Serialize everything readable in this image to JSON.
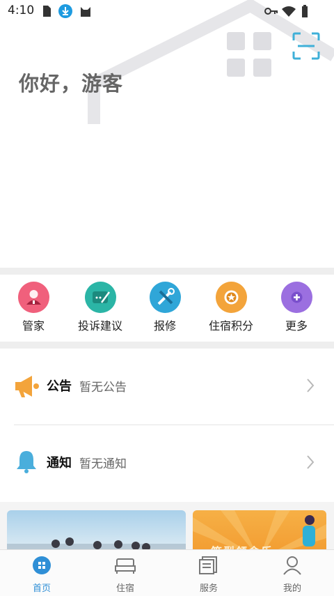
{
  "status_bar": {
    "time": "4:10",
    "icons": [
      "sim-card-icon",
      "download-icon",
      "cat-app-icon",
      "key-icon",
      "wifi-icon",
      "battery-icon"
    ]
  },
  "header": {
    "greeting": "你好，游客",
    "grid_icon": "apps-grid-icon",
    "scan_icon": "scan-icon"
  },
  "quick_actions": [
    {
      "label": "管家",
      "icon": "butler-icon",
      "color": "#f0607c"
    },
    {
      "label": "投诉建议",
      "icon": "feedback-icon",
      "color": "#2bb5a6"
    },
    {
      "label": "报修",
      "icon": "repair-icon",
      "color": "#2fa6d8"
    },
    {
      "label": "住宿积分",
      "icon": "points-icon",
      "color": "#f3a43b"
    },
    {
      "label": "更多",
      "icon": "more-icon",
      "color": "#9b6fe0"
    }
  ],
  "notices": [
    {
      "title": "公告",
      "text": "暂无公告",
      "icon": "megaphone-icon"
    },
    {
      "title": "通知",
      "text": "暂无通知",
      "icon": "bell-icon"
    }
  ],
  "banners": [
    {
      "text": ""
    },
    {
      "text": "笑型领舍乐"
    }
  ],
  "tabs": [
    {
      "label": "首页",
      "icon": "home-icon",
      "active": true
    },
    {
      "label": "住宿",
      "icon": "bed-icon",
      "active": false
    },
    {
      "label": "服务",
      "icon": "service-icon",
      "active": false
    },
    {
      "label": "我的",
      "icon": "user-icon",
      "active": false
    }
  ],
  "colors": {
    "accent": "#2f8fd6",
    "scan": "#3fb0d8",
    "background_band": "#eeeeee"
  }
}
